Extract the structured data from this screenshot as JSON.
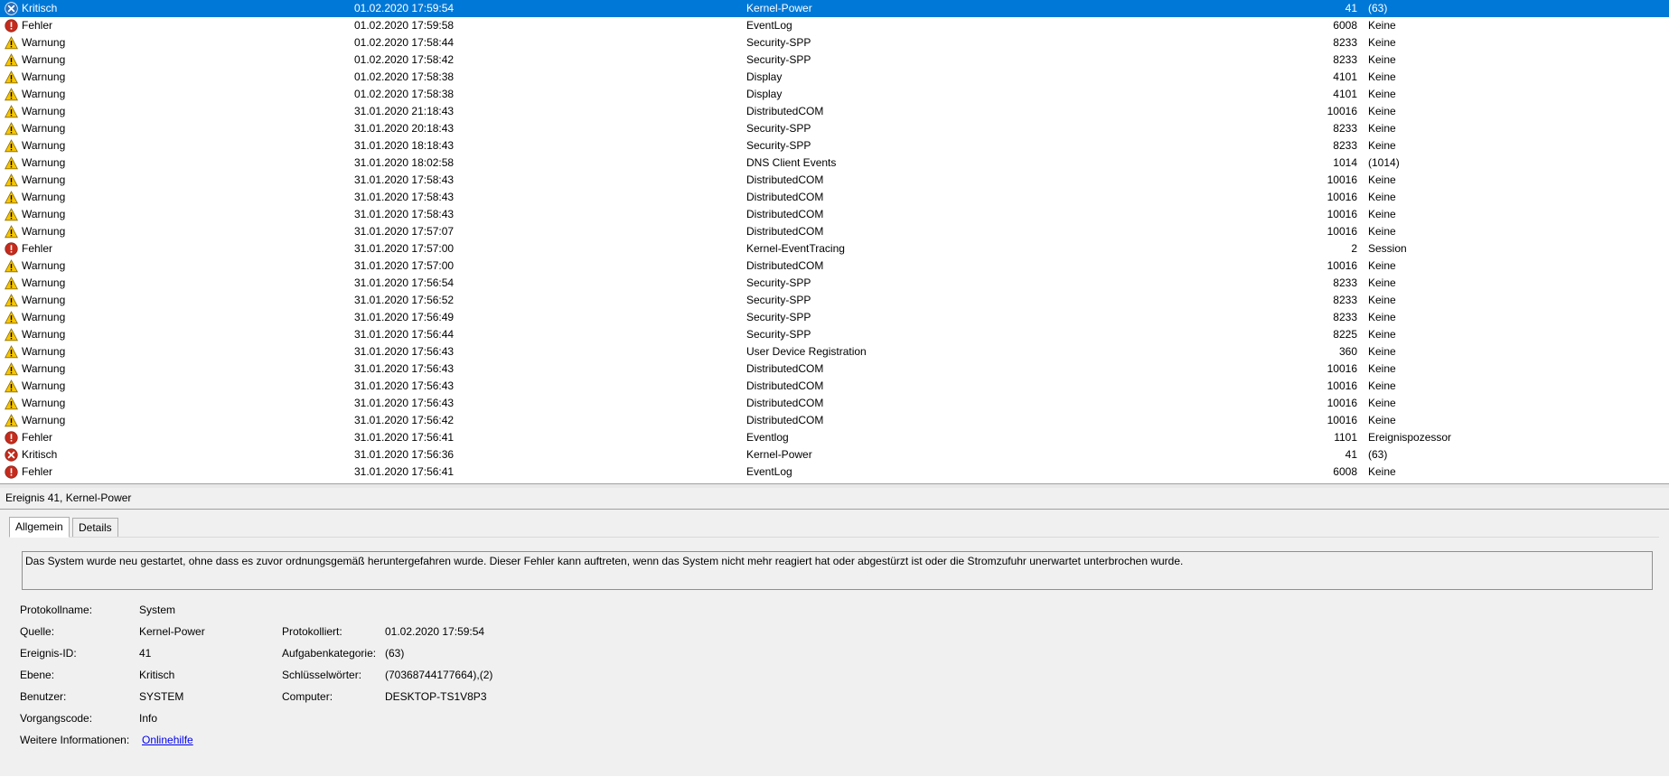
{
  "events": [
    {
      "level": "Kritisch",
      "icon": "critical-icon",
      "date": "01.02.2020 17:59:54",
      "source": "Kernel-Power",
      "id": "41",
      "category": "(63)",
      "selected": true
    },
    {
      "level": "Fehler",
      "icon": "error-icon",
      "date": "01.02.2020 17:59:58",
      "source": "EventLog",
      "id": "6008",
      "category": "Keine"
    },
    {
      "level": "Warnung",
      "icon": "warning-icon",
      "date": "01.02.2020 17:58:44",
      "source": "Security-SPP",
      "id": "8233",
      "category": "Keine"
    },
    {
      "level": "Warnung",
      "icon": "warning-icon",
      "date": "01.02.2020 17:58:42",
      "source": "Security-SPP",
      "id": "8233",
      "category": "Keine"
    },
    {
      "level": "Warnung",
      "icon": "warning-icon",
      "date": "01.02.2020 17:58:38",
      "source": "Display",
      "id": "4101",
      "category": "Keine"
    },
    {
      "level": "Warnung",
      "icon": "warning-icon",
      "date": "01.02.2020 17:58:38",
      "source": "Display",
      "id": "4101",
      "category": "Keine"
    },
    {
      "level": "Warnung",
      "icon": "warning-icon",
      "date": "31.01.2020 21:18:43",
      "source": "DistributedCOM",
      "id": "10016",
      "category": "Keine"
    },
    {
      "level": "Warnung",
      "icon": "warning-icon",
      "date": "31.01.2020 20:18:43",
      "source": "Security-SPP",
      "id": "8233",
      "category": "Keine"
    },
    {
      "level": "Warnung",
      "icon": "warning-icon",
      "date": "31.01.2020 18:18:43",
      "source": "Security-SPP",
      "id": "8233",
      "category": "Keine"
    },
    {
      "level": "Warnung",
      "icon": "warning-icon",
      "date": "31.01.2020 18:02:58",
      "source": "DNS Client Events",
      "id": "1014",
      "category": "(1014)"
    },
    {
      "level": "Warnung",
      "icon": "warning-icon",
      "date": "31.01.2020 17:58:43",
      "source": "DistributedCOM",
      "id": "10016",
      "category": "Keine"
    },
    {
      "level": "Warnung",
      "icon": "warning-icon",
      "date": "31.01.2020 17:58:43",
      "source": "DistributedCOM",
      "id": "10016",
      "category": "Keine"
    },
    {
      "level": "Warnung",
      "icon": "warning-icon",
      "date": "31.01.2020 17:58:43",
      "source": "DistributedCOM",
      "id": "10016",
      "category": "Keine"
    },
    {
      "level": "Warnung",
      "icon": "warning-icon",
      "date": "31.01.2020 17:57:07",
      "source": "DistributedCOM",
      "id": "10016",
      "category": "Keine"
    },
    {
      "level": "Fehler",
      "icon": "error-icon",
      "date": "31.01.2020 17:57:00",
      "source": "Kernel-EventTracing",
      "id": "2",
      "category": "Session"
    },
    {
      "level": "Warnung",
      "icon": "warning-icon",
      "date": "31.01.2020 17:57:00",
      "source": "DistributedCOM",
      "id": "10016",
      "category": "Keine"
    },
    {
      "level": "Warnung",
      "icon": "warning-icon",
      "date": "31.01.2020 17:56:54",
      "source": "Security-SPP",
      "id": "8233",
      "category": "Keine"
    },
    {
      "level": "Warnung",
      "icon": "warning-icon",
      "date": "31.01.2020 17:56:52",
      "source": "Security-SPP",
      "id": "8233",
      "category": "Keine"
    },
    {
      "level": "Warnung",
      "icon": "warning-icon",
      "date": "31.01.2020 17:56:49",
      "source": "Security-SPP",
      "id": "8233",
      "category": "Keine"
    },
    {
      "level": "Warnung",
      "icon": "warning-icon",
      "date": "31.01.2020 17:56:44",
      "source": "Security-SPP",
      "id": "8225",
      "category": "Keine"
    },
    {
      "level": "Warnung",
      "icon": "warning-icon",
      "date": "31.01.2020 17:56:43",
      "source": "User Device Registration",
      "id": "360",
      "category": "Keine"
    },
    {
      "level": "Warnung",
      "icon": "warning-icon",
      "date": "31.01.2020 17:56:43",
      "source": "DistributedCOM",
      "id": "10016",
      "category": "Keine"
    },
    {
      "level": "Warnung",
      "icon": "warning-icon",
      "date": "31.01.2020 17:56:43",
      "source": "DistributedCOM",
      "id": "10016",
      "category": "Keine"
    },
    {
      "level": "Warnung",
      "icon": "warning-icon",
      "date": "31.01.2020 17:56:43",
      "source": "DistributedCOM",
      "id": "10016",
      "category": "Keine"
    },
    {
      "level": "Warnung",
      "icon": "warning-icon",
      "date": "31.01.2020 17:56:42",
      "source": "DistributedCOM",
      "id": "10016",
      "category": "Keine"
    },
    {
      "level": "Fehler",
      "icon": "error-icon",
      "date": "31.01.2020 17:56:41",
      "source": "Eventlog",
      "id": "1101",
      "category": "Ereignispozessor"
    },
    {
      "level": "Kritisch",
      "icon": "critical-icon",
      "date": "31.01.2020 17:56:36",
      "source": "Kernel-Power",
      "id": "41",
      "category": "(63)"
    },
    {
      "level": "Fehler",
      "icon": "error-icon",
      "date": "31.01.2020 17:56:41",
      "source": "EventLog",
      "id": "6008",
      "category": "Keine"
    }
  ],
  "detail": {
    "header": "Ereignis 41, Kernel-Power",
    "tabs": [
      "Allgemein",
      "Details"
    ],
    "description": "Das System wurde neu gestartet, ohne dass es zuvor ordnungsgemäß heruntergefahren wurde. Dieser Fehler kann auftreten, wenn das System nicht mehr reagiert hat oder abgestürzt ist oder die Stromzufuhr unerwartet unterbrochen wurde.",
    "fields": {
      "protokollname": {
        "label": "Protokollname:",
        "value": "System"
      },
      "quelle": {
        "label": "Quelle:",
        "value": "Kernel-Power"
      },
      "ereignis_id": {
        "label": "Ereignis-ID:",
        "value": "41"
      },
      "ebene": {
        "label": "Ebene:",
        "value": "Kritisch"
      },
      "benutzer": {
        "label": "Benutzer:",
        "value": "SYSTEM"
      },
      "vorgangscode": {
        "label": "Vorgangscode:",
        "value": "Info"
      },
      "weitere": {
        "label": "Weitere Informationen:",
        "value": "Onlinehilfe"
      },
      "protokolliert": {
        "label": "Protokolliert:",
        "value": "01.02.2020 17:59:54"
      },
      "aufgabenkategorie": {
        "label": "Aufgabenkategorie:",
        "value": "(63)"
      },
      "schluesselwoerter": {
        "label": "Schlüsselwörter:",
        "value": "(70368744177664),(2)"
      },
      "computer": {
        "label": "Computer:",
        "value": "DESKTOP-TS1V8P3"
      }
    }
  },
  "colors": {
    "selection": "#0078d7",
    "warning": "#f7c600",
    "error": "#c42b1c",
    "critical_selected": "#2a6ebb",
    "link": "#0000ee"
  }
}
